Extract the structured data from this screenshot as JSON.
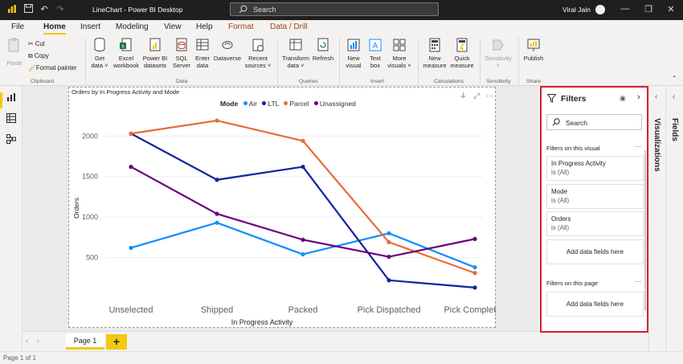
{
  "titlebar": {
    "doc_title": "LineChart - Power BI Desktop",
    "search_label": "Search",
    "user_name": "Viral Jain"
  },
  "menu": {
    "items": [
      "File",
      "Home",
      "Insert",
      "Modeling",
      "View",
      "Help",
      "Format",
      "Data / Drill"
    ],
    "active": "Home"
  },
  "ribbon": {
    "clipboard": {
      "paste": "Paste",
      "cut": "Cut",
      "copy": "Copy",
      "format_painter": "Format painter",
      "group": "Clipboard"
    },
    "data": {
      "get_data": [
        "Get",
        "data ˅"
      ],
      "excel": [
        "Excel",
        "workbook"
      ],
      "pbi_datasets": [
        "Power BI",
        "datasets"
      ],
      "sql": [
        "SQL",
        "Server"
      ],
      "enter_data": [
        "Enter",
        "data"
      ],
      "dataverse": [
        "Dataverse",
        ""
      ],
      "recent_sources": [
        "Recent",
        "sources ˅"
      ],
      "group": "Data"
    },
    "queries": {
      "transform": [
        "Transform",
        "data ˅"
      ],
      "refresh": [
        "Refresh",
        ""
      ],
      "group": "Queries"
    },
    "insert": {
      "new_visual": [
        "New",
        "visual"
      ],
      "text_box": [
        "Text",
        "box"
      ],
      "more_visuals": [
        "More",
        "visuals ˅"
      ],
      "group": "Insert"
    },
    "calculations": {
      "new_measure": [
        "New",
        "measure"
      ],
      "quick_measure": [
        "Quick",
        "measure"
      ],
      "group": "Calculations"
    },
    "sensitivity": {
      "label": [
        "Sensitivity",
        "˅"
      ],
      "group": "Sensitivity"
    },
    "share": {
      "publish": [
        "Publish",
        ""
      ],
      "group": "Share"
    }
  },
  "visual": {
    "title": "Orders by In Progress Activity and Mode",
    "legend_title": "Mode",
    "legend": [
      {
        "name": "Air",
        "color": "#118dff"
      },
      {
        "name": "LTL",
        "color": "#12239e"
      },
      {
        "name": "Parcel",
        "color": "#e66c37"
      },
      {
        "name": "Unassigned",
        "color": "#6b007b"
      }
    ]
  },
  "chart_data": {
    "type": "line",
    "title": "Orders by In Progress Activity and Mode",
    "xlabel": "In Progress Activity",
    "ylabel": "Orders",
    "categories": [
      "Unselected",
      "Shipped",
      "Packed",
      "Pick Dispatched",
      "Pick Completed"
    ],
    "yticks": [
      500,
      1000,
      1500,
      2000
    ],
    "ylim": [
      0,
      2300
    ],
    "grid": true,
    "legend_position": "top",
    "series": [
      {
        "name": "Air",
        "color": "#118dff",
        "values": [
          620,
          930,
          540,
          800,
          380
        ]
      },
      {
        "name": "LTL",
        "color": "#12239e",
        "values": [
          2030,
          1460,
          1620,
          220,
          130
        ]
      },
      {
        "name": "Parcel",
        "color": "#e66c37",
        "values": [
          2030,
          2190,
          1940,
          690,
          310
        ]
      },
      {
        "name": "Unassigned",
        "color": "#6b007b",
        "values": [
          1620,
          1040,
          720,
          510,
          730
        ]
      }
    ]
  },
  "pages": {
    "tabs": [
      "Page 1"
    ],
    "add": "+"
  },
  "status": {
    "text": "Page 1 of 1"
  },
  "filters": {
    "title": "Filters",
    "search_placeholder": "Search",
    "visual_section": "Filters on this visual",
    "cards": [
      {
        "name": "In Progress Activity",
        "value": "is (All)"
      },
      {
        "name": "Mode",
        "value": "is (All)"
      },
      {
        "name": "Orders",
        "value": "is (All)"
      }
    ],
    "add_fields": "Add data fields here",
    "page_section": "Filters on this page",
    "add_fields_page": "Add data fields here"
  },
  "panes": {
    "visualizations": "Visualizations",
    "fields": "Fields"
  }
}
